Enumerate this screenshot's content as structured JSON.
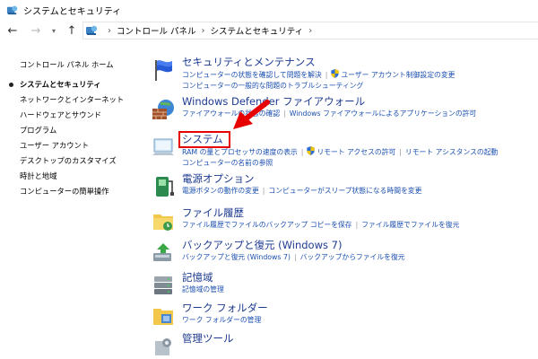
{
  "window": {
    "title": "システムとセキュリティ"
  },
  "nav": {
    "back_glyph": "←",
    "forward_glyph": "→",
    "dropdown_glyph": "▾",
    "up_glyph": "↑",
    "breadcrumb": [
      "コントロール パネル",
      "システムとセキュリティ"
    ],
    "separator": "›"
  },
  "sidebar": {
    "home": "コントロール パネル ホーム",
    "items": [
      "システムとセキュリティ",
      "ネットワークとインターネット",
      "ハードウェアとサウンド",
      "プログラム",
      "ユーザー アカウント",
      "デスクトップのカスタマイズ",
      "時計と地域",
      "コンピューターの簡単操作"
    ]
  },
  "sections": [
    {
      "title": "セキュリティとメンテナンス",
      "icon": "flag-icon",
      "lines": [
        [
          "コンピューターの状態を確認して問題を解決",
          "ユーザー アカウント制御設定の変更"
        ],
        [
          "コンピューターの一般的な問題のトラブルシューティング"
        ]
      ]
    },
    {
      "title": "Windows Defender ファイアウォール",
      "icon": "firewall-icon",
      "lines": [
        [
          "ファイアウォールの状態の確認",
          "Windows ファイアウォールによるアプリケーションの許可"
        ]
      ]
    },
    {
      "title": "システム",
      "icon": "computer-icon",
      "lines": [
        [
          "RAM の量とプロセッサの速度の表示",
          "リモート アクセスの許可",
          "リモート アシスタンスの起動"
        ],
        [
          "コンピューターの名前の参照"
        ]
      ]
    },
    {
      "title": "電源オプション",
      "icon": "power-icon",
      "lines": [
        [
          "電源ボタンの動作の変更",
          "コンピューターがスリープ状態になる時間を変更"
        ]
      ]
    },
    {
      "title": "ファイル履歴",
      "icon": "file-history-icon",
      "lines": [
        [
          "ファイル履歴でファイルのバックアップ コピーを保存",
          "ファイル履歴でファイルを復元"
        ]
      ]
    },
    {
      "title": "バックアップと復元 (Windows 7)",
      "icon": "backup-icon",
      "lines": [
        [
          "バックアップと復元 (Windows 7)",
          "バックアップからファイルを復元"
        ]
      ]
    },
    {
      "title": "記憶域",
      "icon": "storage-icon",
      "lines": [
        [
          "記憶域の管理"
        ]
      ]
    },
    {
      "title": "ワーク フォルダー",
      "icon": "work-folders-icon",
      "lines": [
        [
          "ワーク フォルダーの管理"
        ]
      ]
    },
    {
      "title": "管理ツール",
      "icon": "admin-tools-icon",
      "lines": []
    }
  ],
  "colors": {
    "title": "#1c3a8f",
    "link": "#1a4fb0",
    "highlight": "#e60000"
  }
}
